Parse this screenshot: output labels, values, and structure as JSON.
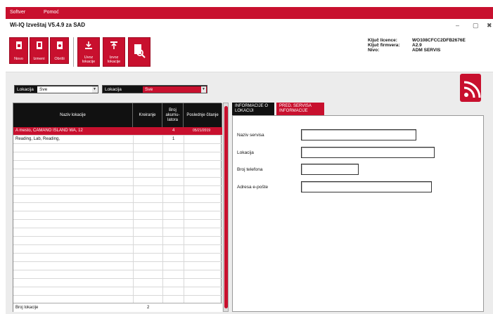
{
  "menu": {
    "items": [
      "Softver",
      "Pomoć"
    ]
  },
  "window": {
    "title": "Wi-IQ Izveštaj V5.4.9 za SAD",
    "minimize": "–",
    "maximize": "▢",
    "close": "✖"
  },
  "toolbar": {
    "buttons": [
      "Novo",
      "Izmeni",
      "Obriši",
      "Uvoz\nlokacije",
      "Izvoz\nlokacije"
    ]
  },
  "license": {
    "labels": [
      "Ključ licence:",
      "Ključ firmvera:",
      "Nivo:"
    ],
    "values": [
      "WO108CFCC2DFB2676E",
      "A2.9",
      "ADM SERVIS"
    ]
  },
  "filters": {
    "lokacija1": {
      "label": "Lokacija",
      "value": "Sve"
    },
    "lokacija2": {
      "label": "Lokacija",
      "value": "Sve"
    }
  },
  "table": {
    "headers": [
      "Naziv lokacije",
      "Kreiranje",
      "Broj akumu- latora",
      "Poslednje čitanje"
    ],
    "rows": [
      {
        "name": "A mesto, CAMANO ISLAND WA, 12",
        "kreiranje": "",
        "broj": "4",
        "poslednje": "05/21/2019"
      },
      {
        "name": "Reading, Lab, Reading,",
        "kreiranje": "",
        "broj": "1",
        "poslednje": ""
      }
    ],
    "footer_label": "Broj lokacije",
    "footer_value": "2"
  },
  "tabs": [
    "INFORMACIJE O LOKACIJI",
    "PRED. SERVISA INFORMACIJE"
  ],
  "form": {
    "labels": [
      "Naziv servisa",
      "Lokacija",
      "Broj telefona",
      "Adresa e-pošte"
    ],
    "values": [
      "",
      "",
      "",
      ""
    ]
  },
  "colors": {
    "accent": "#c8102e",
    "dark": "#111111"
  },
  "icons": [
    "new-doc-icon",
    "edit-doc-icon",
    "delete-doc-icon",
    "import-icon",
    "export-icon",
    "search-report-icon",
    "wifi-logo-icon"
  ]
}
